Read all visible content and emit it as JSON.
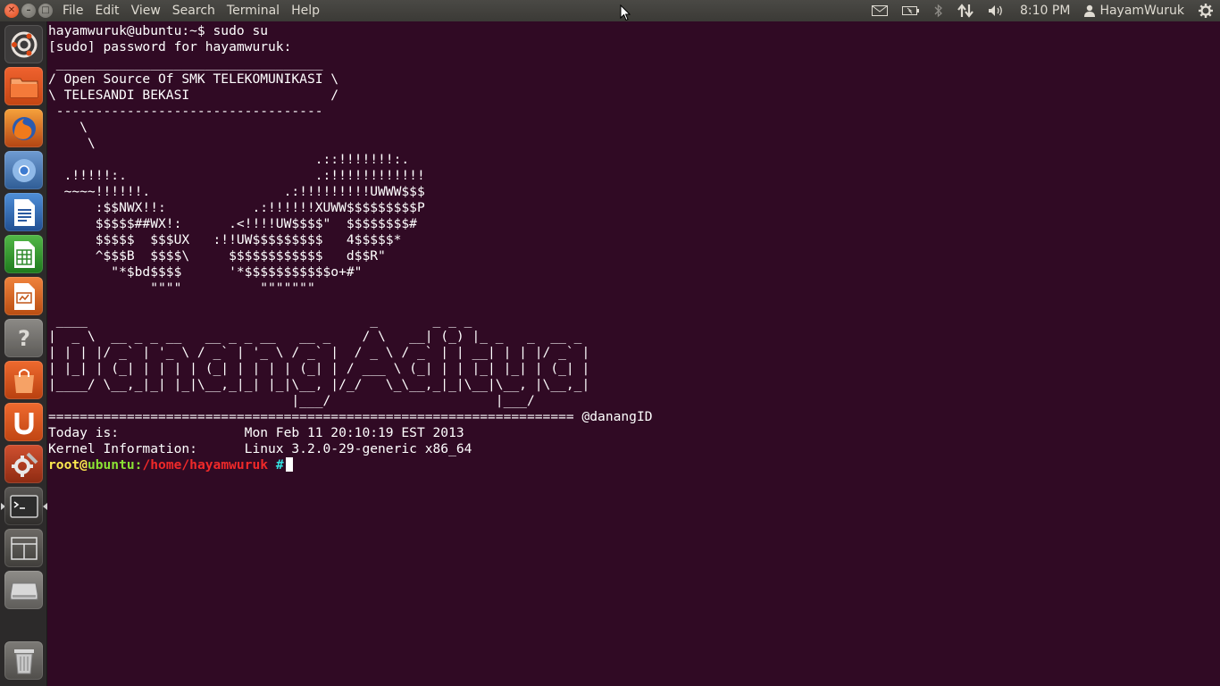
{
  "menubar": {
    "items": [
      "File",
      "Edit",
      "View",
      "Search",
      "Terminal",
      "Help"
    ]
  },
  "indicators": {
    "time": "8:10 PM",
    "user": "HayamWuruk"
  },
  "launcher": {
    "apps": [
      "dash-home-icon",
      "files-icon",
      "firefox-icon",
      "chromium-icon",
      "writer-icon",
      "calc-icon",
      "impress-icon",
      "help-icon",
      "software-center-icon",
      "ubuntu-one-icon",
      "system-settings-icon",
      "terminal-icon",
      "workspace-switcher-icon",
      "drive-icon",
      "trash-icon"
    ]
  },
  "terminal": {
    "lines": [
      "hayamwuruk@ubuntu:~$ sudo su",
      "[sudo] password for hayamwuruk:",
      " __________________________________",
      "/ Open Source Of SMK TELEKOMUNIKASI \\",
      "\\ TELESANDI BEKASI                  /",
      " ----------------------------------",
      "    \\",
      "     \\",
      "                                  .::!!!!!!!:.",
      "  .!!!!!:.                        .:!!!!!!!!!!!!",
      "  ~~~~!!!!!!.                 .:!!!!!!!!!UWWW$$$",
      "      :$$NWX!!:           .:!!!!!!XUWW$$$$$$$$$P",
      "      $$$$$##WX!:      .<!!!!UW$$$$\"  $$$$$$$$#",
      "      $$$$$  $$$UX   :!!UW$$$$$$$$$   4$$$$$*",
      "      ^$$$B  $$$$\\     $$$$$$$$$$$$   d$$R\"",
      "        \"*$bd$$$$      '*$$$$$$$$$$$o+#\"",
      "             \"\"\"\"          \"\"\"\"\"\"\"",
      "",
      " ____                                    _       _ _ _",
      "|  _ \\  __ _ _ __   __ _ _ __   __ _    / \\   __| (_) |_ _   _  __ _",
      "| | | |/ _` | '_ \\ / _` | '_ \\ / _` |  / _ \\ / _` | | __| | | |/ _` |",
      "| |_| | (_| | | | | (_| | | | | (_| | / ___ \\ (_| | | |_| |_| | (_| |",
      "|____/ \\__,_|_| |_|\\__,_|_| |_|\\__, |/_/   \\_\\__,_|_|\\__|\\__, |\\__,_|",
      "                               |___/                     |___/",
      "=================================================================== @danangID",
      "Today is:                Mon Feb 11 20:10:19 EST 2013",
      "Kernel Information:      Linux 3.2.0-29-generic x86_64"
    ],
    "prompt": {
      "user": "root",
      "at": "@",
      "host": "ubuntu",
      "colon": ":",
      "path": "/home/hayamwuruk",
      "hash": " #"
    }
  }
}
